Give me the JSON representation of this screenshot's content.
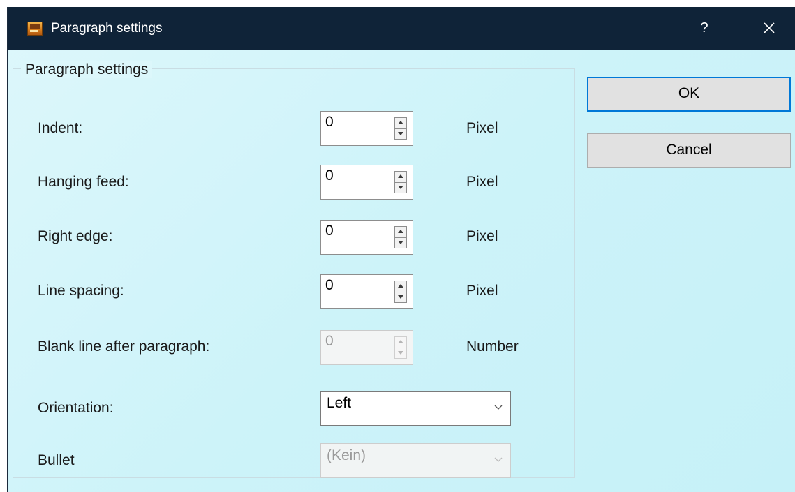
{
  "window": {
    "title": "Paragraph settings",
    "help_glyph": "?",
    "close_icon": "close-icon"
  },
  "group": {
    "label": "Paragraph settings"
  },
  "fields": {
    "indent": {
      "label": "Indent:",
      "value": "0",
      "unit": "Pixel",
      "enabled": true
    },
    "hanging_feed": {
      "label": "Hanging feed:",
      "value": "0",
      "unit": "Pixel",
      "enabled": true
    },
    "right_edge": {
      "label": "Right edge:",
      "value": "0",
      "unit": "Pixel",
      "enabled": true
    },
    "line_spacing": {
      "label": "Line spacing:",
      "value": "0",
      "unit": "Pixel",
      "enabled": true
    },
    "blank_line": {
      "label": "Blank line after paragraph:",
      "value": "0",
      "unit": "Number",
      "enabled": false
    },
    "orientation": {
      "label": "Orientation:",
      "value": "Left",
      "enabled": true
    },
    "bullet": {
      "label": "Bullet",
      "value": "(Kein)",
      "enabled": false
    }
  },
  "buttons": {
    "ok": "OK",
    "cancel": "Cancel"
  },
  "colors": {
    "titlebar": "#0f2338",
    "background": "#cdf3f9",
    "accent": "#0078d7"
  }
}
